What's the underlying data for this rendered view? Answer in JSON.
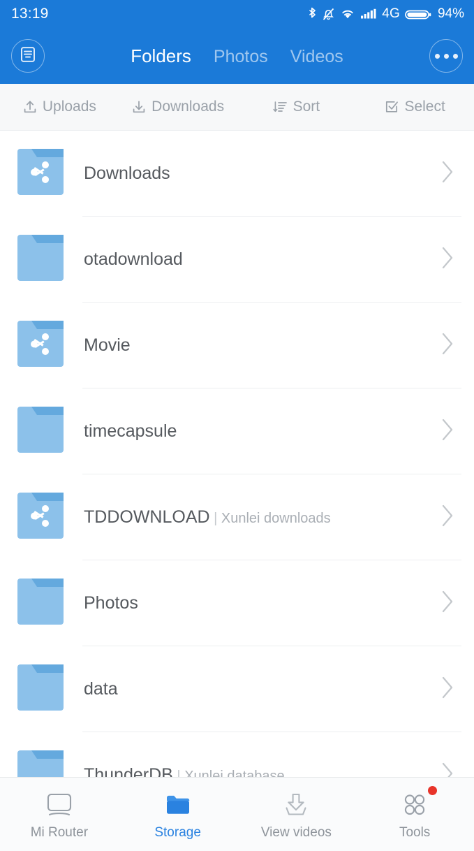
{
  "status_bar": {
    "time": "13:19",
    "icons": [
      "bluetooth-icon",
      "alarm-muted-icon",
      "wifi-icon",
      "signal-bars-icon"
    ],
    "network": "4G",
    "battery_percent": "94%"
  },
  "header": {
    "menu_icon": "document-list-icon",
    "overflow_icon": "more-options-icon",
    "tabs": [
      {
        "label": "Folders",
        "active": true
      },
      {
        "label": "Photos",
        "active": false
      },
      {
        "label": "Videos",
        "active": false
      }
    ]
  },
  "toolbar": {
    "items": [
      {
        "label": "Uploads",
        "icon": "upload-icon"
      },
      {
        "label": "Downloads",
        "icon": "download-icon"
      },
      {
        "label": "Sort",
        "icon": "sort-icon"
      },
      {
        "label": "Select",
        "icon": "checkbox-icon"
      }
    ]
  },
  "file_list": {
    "rows": [
      {
        "name": "Downloads",
        "desc": "",
        "shared": true
      },
      {
        "name": "otadownload",
        "desc": "",
        "shared": false
      },
      {
        "name": "Movie",
        "desc": "",
        "shared": true
      },
      {
        "name": "timecapsule",
        "desc": "",
        "shared": false
      },
      {
        "name": "TDDOWNLOAD",
        "desc": "Xunlei downloads",
        "shared": true
      },
      {
        "name": "Photos",
        "desc": "",
        "shared": false
      },
      {
        "name": "data",
        "desc": "",
        "shared": false
      },
      {
        "name": "ThunderDB",
        "desc": "Xunlei database",
        "shared": false
      }
    ],
    "separator": "|",
    "chevron_icon": "chevron-right-icon"
  },
  "bottom_nav": {
    "items": [
      {
        "label": "Mi Router",
        "icon": "router-icon",
        "active": false,
        "badge": false
      },
      {
        "label": "Storage",
        "icon": "folder-icon",
        "active": true,
        "badge": false
      },
      {
        "label": "View videos",
        "icon": "download-tray-icon",
        "active": false,
        "badge": false
      },
      {
        "label": "Tools",
        "icon": "grid-circles-icon",
        "active": false,
        "badge": true
      }
    ]
  },
  "colors": {
    "header_blue": "#1b7ad8",
    "accent_blue": "#2a82e0",
    "folder_blue": "#8cc1ea",
    "folder_tab_blue": "#64a9de",
    "badge_red": "#e8342a",
    "text_primary": "#55595e",
    "text_muted": "#a9aeb4"
  }
}
